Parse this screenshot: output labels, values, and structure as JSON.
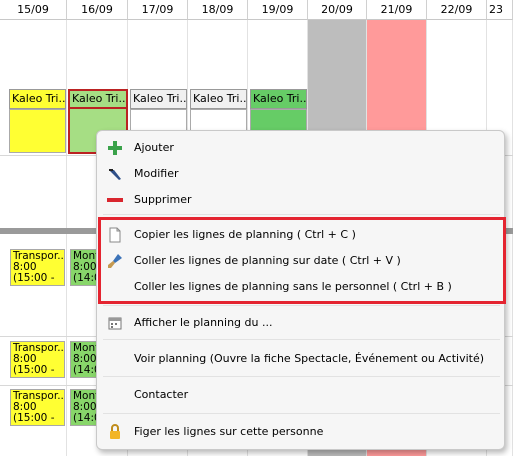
{
  "calendar": {
    "dates": [
      "15/09",
      "16/09",
      "17/09",
      "18/09",
      "19/09",
      "20/09",
      "21/09",
      "22/09",
      "23"
    ],
    "events": [
      "Kaleo Tri...",
      "Kaleo Tri...",
      "Kaleo Tri...",
      "Kaleo Tri...",
      "Kaleo Tri..."
    ],
    "tasks": [
      {
        "l1": "Transpor...",
        "l2": "8:00",
        "l3": "(15:00 -"
      },
      {
        "l1": "Mont",
        "l2": "8:00",
        "l3": "(14:0"
      },
      {
        "l1": "Transpor...",
        "l2": "8:00",
        "l3": "(15:00 -"
      },
      {
        "l1": "Mont",
        "l2": "8:00",
        "l3": "(14:0"
      },
      {
        "l1": "Transpor...",
        "l2": "8:00",
        "l3": "(15:00 -"
      },
      {
        "l1": "Mont",
        "l2": "8:00",
        "l3": "(14:0"
      }
    ]
  },
  "menu": {
    "items": [
      {
        "label": "Ajouter",
        "icon": "plus-icon"
      },
      {
        "label": "Modifier",
        "icon": "edit-icon"
      },
      {
        "label": "Supprimer",
        "icon": "minus-icon"
      },
      {
        "label": "Copier les lignes de planning ( Ctrl + C )",
        "icon": "copy-icon"
      },
      {
        "label": "Coller les lignes de planning sur date ( Ctrl + V )",
        "icon": "paste-brush-icon"
      },
      {
        "label": "Coller les lignes de planning sans le personnel ( Ctrl + B )",
        "icon": ""
      },
      {
        "label": "Afficher le planning du ...",
        "icon": "calendar-icon"
      },
      {
        "label": "Voir planning (Ouvre la fiche Spectacle, Événement ou Activité)",
        "icon": ""
      },
      {
        "label": "Contacter",
        "icon": ""
      },
      {
        "label": "Figer les lignes sur cette personne",
        "icon": "lock-icon"
      }
    ]
  },
  "colors": {
    "weekend_grey": "#bdbdbd",
    "holiday_pink": "#ff9a9a",
    "event_yellow": "#ffff33",
    "event_green": "#66cc66",
    "highlight_red": "#e42430"
  }
}
